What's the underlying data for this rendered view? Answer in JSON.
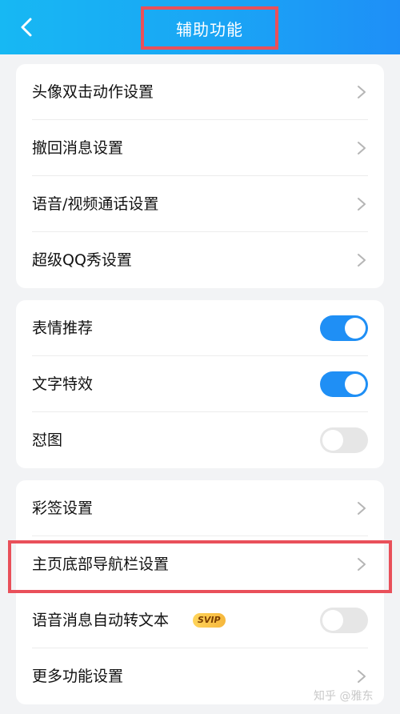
{
  "header": {
    "title": "辅助功能",
    "back_icon": "back-arrow-icon"
  },
  "cards": [
    {
      "rows": [
        {
          "label": "头像双击动作设置",
          "control": "chevron"
        },
        {
          "label": "撤回消息设置",
          "control": "chevron"
        },
        {
          "label": "语音/视频通话设置",
          "control": "chevron"
        },
        {
          "label": "超级QQ秀设置",
          "control": "chevron"
        }
      ]
    },
    {
      "rows": [
        {
          "label": "表情推荐",
          "control": "toggle",
          "state": "on"
        },
        {
          "label": "文字特效",
          "control": "toggle",
          "state": "on"
        },
        {
          "label": "怼图",
          "control": "toggle",
          "state": "off"
        }
      ]
    },
    {
      "rows": [
        {
          "label": "彩签设置",
          "control": "chevron"
        },
        {
          "label": "主页底部导航栏设置",
          "control": "chevron",
          "highlighted": true
        },
        {
          "label": "语音消息自动转文本",
          "badge": "SVIP",
          "control": "toggle",
          "state": "off"
        },
        {
          "label": "更多功能设置",
          "control": "chevron"
        }
      ]
    }
  ],
  "watermark": "知乎 @雅东",
  "colors": {
    "header_start": "#17b8f3",
    "header_end": "#1e8ff7",
    "toggle_on": "#1f8ff5",
    "toggle_off": "#e6e6e6",
    "highlight_border": "#e9505a",
    "background": "#f2f3f5"
  }
}
